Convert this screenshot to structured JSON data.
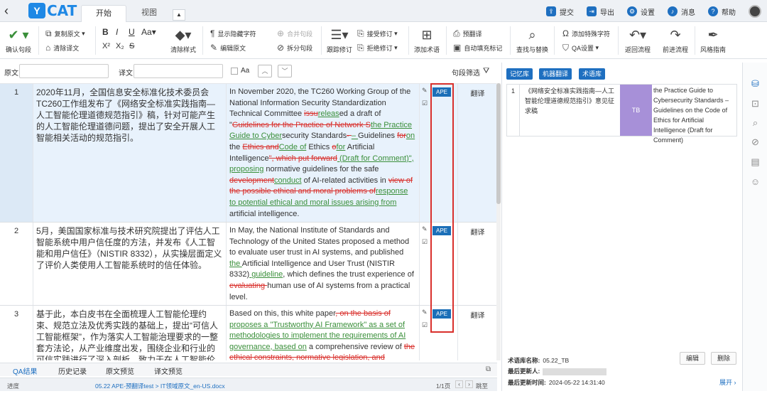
{
  "app": {
    "back_icon": "chevron-left-icon",
    "logo_letter": "Y",
    "logo_text": "CAT",
    "tabs": [
      "开始",
      "视图"
    ],
    "top_right": [
      {
        "label": "提交",
        "icon": "submit-icon",
        "color": "#1e6fc0"
      },
      {
        "label": "导出",
        "icon": "export-icon",
        "color": "#1e6fc0"
      },
      {
        "label": "设置",
        "icon": "gear-icon",
        "color": "#1e6fc0"
      },
      {
        "label": "消息",
        "icon": "bell-icon",
        "color": "#1e6fc0"
      },
      {
        "label": "帮助",
        "icon": "help-icon",
        "color": "#1e6fc0"
      }
    ]
  },
  "ribbon": {
    "confirm": "确认句段",
    "copy_source": "复制原文",
    "clear_translation": "清除译文",
    "bold": "B",
    "italic": "I",
    "underline": "U",
    "case": "Aa",
    "superscript": "X²",
    "subscript": "X₂",
    "strike": "S",
    "clear_style": "清除样式",
    "show_hidden": "显示隐藏字符",
    "edit_source": "编辑原文",
    "merge": "合并句段",
    "split": "拆分句段",
    "track": "跟踪修订",
    "accept": "接受修订",
    "reject": "拒绝修订",
    "add_term": "添加术语",
    "pretranslate": "预翻译",
    "autofill": "自动填充标记",
    "find_replace": "查找与替换",
    "add_special": "添加特殊字符",
    "qa_settings": "QA设置",
    "undo": "返回流程",
    "forward": "前进流程",
    "style_guide": "风格指南"
  },
  "filter": {
    "source_label": "原文",
    "target_label": "译文",
    "case_label": "Aa",
    "segment_filter": "句段筛选"
  },
  "segments": [
    {
      "num": "1",
      "source": "2020年11月，全国信息安全标准化技术委员会TC260工作组发布了《网络安全标准实践指南—人工智能伦理道德规范指引》稿，针对可能产生的人工智能伦理道德问题，提出了安全开展人工智能相关活动的规范指引。",
      "target_html": "In November 2020, the TC260 Working Group of the National Information Security Standardization Technical Committee <span class=\"del\">issu</span><span class=\"ins\">releas</span>ed a draft of \"<span class=\"del\">Guidelines for the Practice of Network S</span><span class=\"ins\">the Practice Guide to Cyber</span>security Standards<span class=\"del\">- </span><span class=\"ins\"> – </span>Guidelines <span class=\"del\">for</span><span class=\"ins\">on</span> the <span class=\"del\">Ethics and</span><span class=\"ins\">Code of</span> Ethics <span class=\"del\">o</span><span class=\"ins\">for</span> Artificial Intelligence<span class=\"del\">\", which put forward</span><span class=\"ins\"> (Draft for Comment)\", proposing</span> normative guidelines for the safe <span class=\"del\">development</span><span class=\"ins\">conduct</span> of AI-related activities in <span class=\"del\">view of the possible ethical and moral problems o</span><span class=\"del\">f</span><span class=\"ins\">response to potential ethical and moral issues arising from</span> artificial intelligence.",
      "ape": "APE",
      "status": "翻译"
    },
    {
      "num": "2",
      "source": "5月，美国国家标准与技术研究院提出了评估人工智能系统中用户信任度的方法，并发布《人工智能和用户信任》（NISTIR 8332），从实操层面定义了评价人类使用人工智能系统时的信任体验。",
      "target_html": "In May, the National Institute of Standards and Technology of the United States proposed a method to evaluate user trust in AI systems, and published <span class=\"ins\">the </span>Artificial Intelligence and User Trust (NISTIR 8332)<span class=\"ins\"> guideline</span>, which defines the trust experience of <span class=\"del\">evaluating </span>human use of AI systems from a practical level.",
      "ape": "APE",
      "status": "翻译"
    },
    {
      "num": "3",
      "source": "基于此，本白皮书在全面梳理人工智能伦理约束、规范立法及优秀实践的基础上，提出“可信人工智能框架”，作为落实人工智能治理要求的一整套方法论，从产业维度出发，围绕企业和行业的可信实践进行了深入剖析，致力于在人工智能伦理和产业",
      "target_html": "Based on this, this white paper<span class=\"del\">, on the basis of</span> <span class=\"ins\">proposes a \"Trustworthy AI Framework\" as a set of methodologies to implement the requirements of AI governance, based on</span> a comprehensive review of <span class=\"del\">the ethical constraints, normative legislation, and</span>",
      "ape": "APE",
      "status": "翻译"
    }
  ],
  "bottom_tabs": [
    "QA结果",
    "历史记录",
    "原文预览",
    "译文预览"
  ],
  "statusbar": {
    "progress_label": "进度",
    "file_text": "05.22 APE-预翻译test > IT领域原文_en-US.docx",
    "page": "1/1页",
    "jump": "跳至"
  },
  "right_panel": {
    "buttons": [
      "记忆库",
      "机器翻译",
      "术语库"
    ],
    "term": {
      "num": "1",
      "source": "《网络安全标准实践指南—人工智能伦理道德规范指引》意见征求稿",
      "badge": "TB",
      "target": "the Practice Guide to Cybersecurity Standards – Guidelines on the Code of Ethics for Artificial Intelligence (Draft for Comment)"
    },
    "meta_name_label": "术语库名称:",
    "meta_name": "05.22_TB",
    "meta_updater_label": "最后更新人:",
    "meta_time_label": "最后更新时间:",
    "meta_time": "2024-05-22 14:31:40",
    "edit": "编辑",
    "delete": "删除",
    "expand": "展开"
  },
  "colors": {
    "accent": "#1e6fc0",
    "insert": "#3a8f3a",
    "delete": "#d9302c",
    "tb_badge": "#a790d8"
  }
}
